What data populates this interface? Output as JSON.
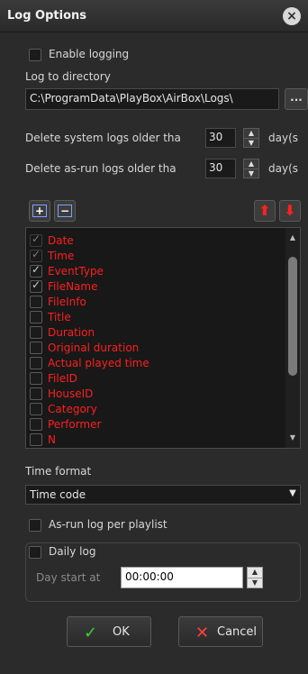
{
  "window": {
    "title": "Log Options"
  },
  "enable_logging": {
    "label": "Enable logging",
    "checked": false
  },
  "log_dir": {
    "label": "Log to directory",
    "path": "C:\\ProgramData\\PlayBox\\AirBox\\Logs\\",
    "browse_label": "..."
  },
  "system_logs": {
    "label": "Delete system logs older tha",
    "value": "30",
    "unit": "day(s"
  },
  "asrun_logs": {
    "label": "Delete as-run logs older tha",
    "value": "30",
    "unit": "day(s"
  },
  "toolbar": {
    "add_symbol": "+",
    "remove_symbol": "−",
    "up_arrow": "⬆",
    "down_arrow": "⬇"
  },
  "fields": [
    {
      "label": "Date",
      "checked": true,
      "dim": true
    },
    {
      "label": "Time",
      "checked": true,
      "dim": true
    },
    {
      "label": "EventType",
      "checked": true,
      "dim": false
    },
    {
      "label": "FileName",
      "checked": true,
      "dim": false
    },
    {
      "label": "FileInfo",
      "checked": false,
      "dim": false
    },
    {
      "label": "Title",
      "checked": false,
      "dim": false
    },
    {
      "label": "Duration",
      "checked": false,
      "dim": false
    },
    {
      "label": "Original duration",
      "checked": false,
      "dim": false
    },
    {
      "label": "Actual played time",
      "checked": false,
      "dim": false
    },
    {
      "label": "FileID",
      "checked": false,
      "dim": false
    },
    {
      "label": "HouseID",
      "checked": false,
      "dim": false
    },
    {
      "label": "Category",
      "checked": false,
      "dim": false
    },
    {
      "label": "Performer",
      "checked": false,
      "dim": false
    },
    {
      "label": "N",
      "checked": false,
      "dim": false
    }
  ],
  "time_format": {
    "label": "Time format",
    "value": "Time code"
  },
  "asrun_per_playlist": {
    "label": "As-run log per playlist",
    "checked": false
  },
  "daily_log": {
    "label": "Daily log",
    "checked": false,
    "day_start_label": "Day start at",
    "day_start_value": "00:00:00"
  },
  "buttons": {
    "ok": "OK",
    "cancel": "Cancel"
  },
  "colors": {
    "field_text": "#ff1f1f",
    "background": "#2b2b2b",
    "ok_icon": "#3cd23c",
    "cancel_icon": "#ff4040"
  }
}
